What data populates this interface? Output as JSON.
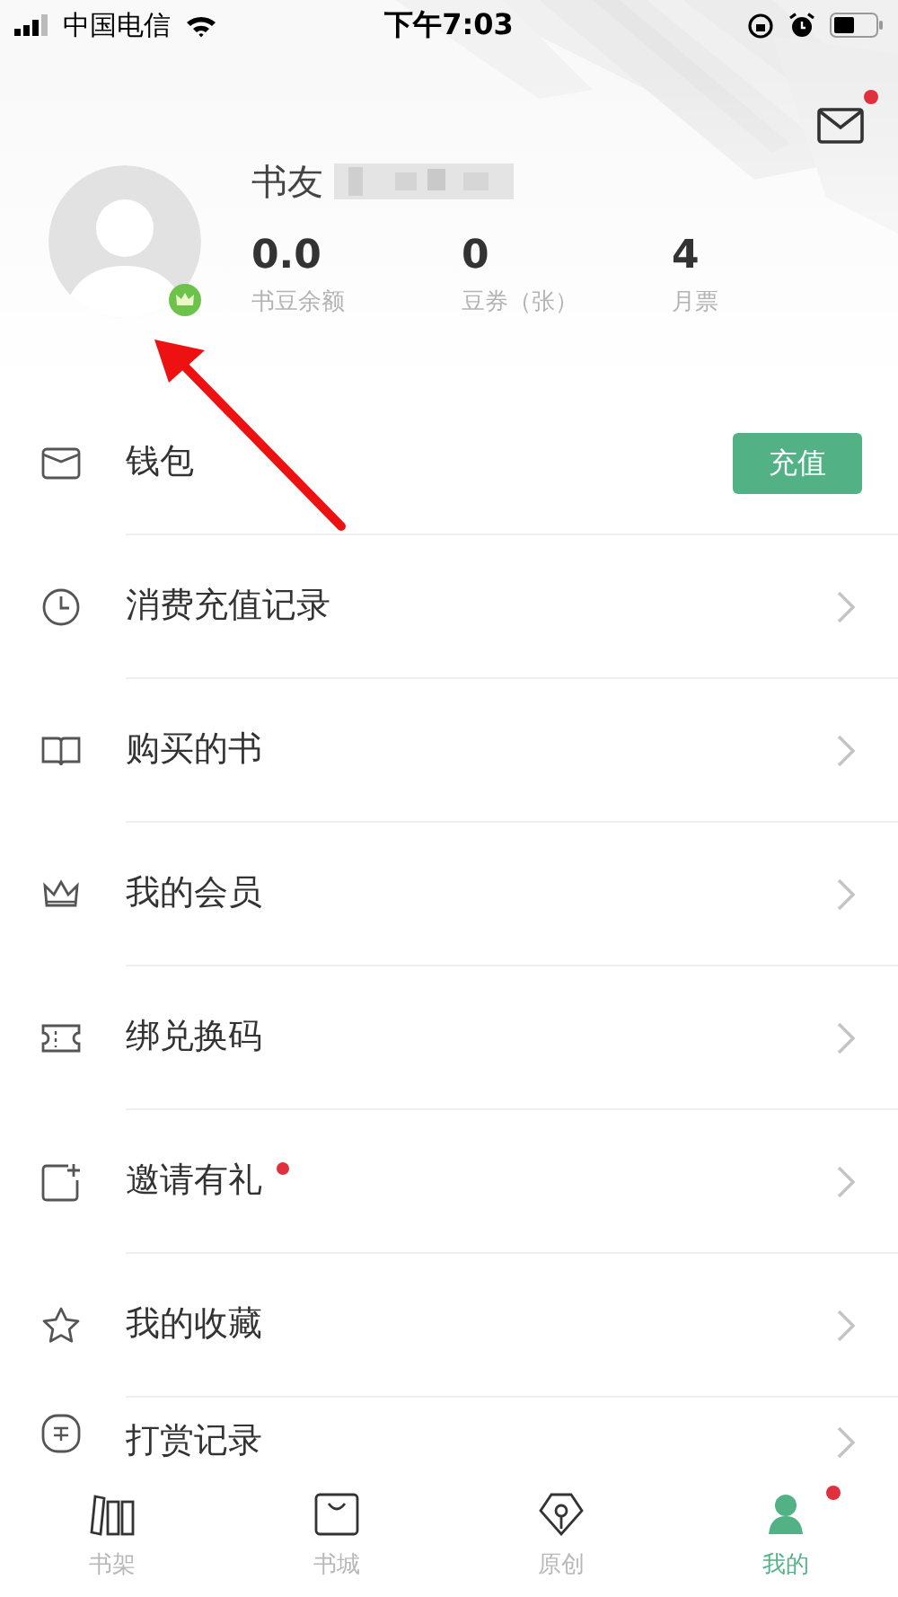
{
  "status_bar": {
    "carrier": "中国电信",
    "time": "下午7:03"
  },
  "header": {
    "mail_unread": true,
    "name_prefix": "书友",
    "vip": true,
    "stats": [
      {
        "value": "0.0",
        "label": "书豆余额"
      },
      {
        "value": "0",
        "label": "豆券（张）"
      },
      {
        "value": "4",
        "label": "月票"
      }
    ]
  },
  "menu": [
    {
      "label": "钱包",
      "kind": "button",
      "button_label": "充值",
      "dot": false
    },
    {
      "label": "消费充值记录",
      "kind": "arrow",
      "dot": false
    },
    {
      "label": "购买的书",
      "kind": "arrow",
      "dot": false
    },
    {
      "label": "我的会员",
      "kind": "arrow",
      "dot": false
    },
    {
      "label": "绑兑换码",
      "kind": "arrow",
      "dot": false
    },
    {
      "label": "邀请有礼",
      "kind": "arrow",
      "dot": true
    },
    {
      "label": "我的收藏",
      "kind": "arrow",
      "dot": false
    },
    {
      "label": "打赏记录",
      "kind": "arrow",
      "dot": false
    }
  ],
  "tabs": [
    {
      "label": "书架",
      "selected": false,
      "dot": false
    },
    {
      "label": "书城",
      "selected": false,
      "dot": false
    },
    {
      "label": "原创",
      "selected": false,
      "dot": false
    },
    {
      "label": "我的",
      "selected": true,
      "dot": true
    }
  ]
}
